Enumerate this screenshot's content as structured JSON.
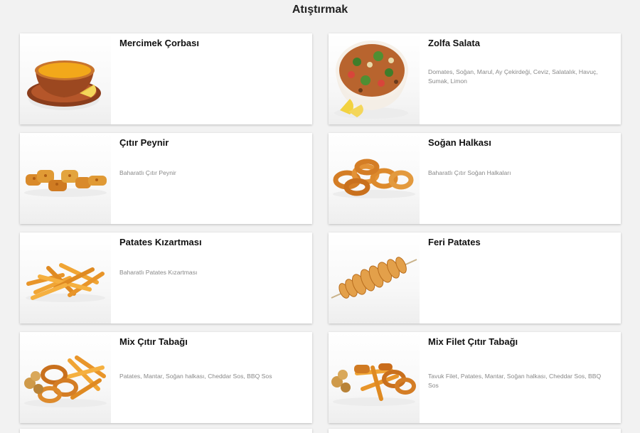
{
  "page": {
    "title": "Atıştırmak"
  },
  "items": [
    {
      "name": "Mercimek Çorbası",
      "description": "",
      "image": "lentil-soup-bowl"
    },
    {
      "name": "Zolfa Salata",
      "description": "Domates, Soğan, Marul, Ay Çekirdeği, Ceviz, Salatalık, Havuç, Sumak, Limon",
      "image": "salad-bowl"
    },
    {
      "name": "Çıtır Peynir",
      "description": "Baharatlı Çıtır Peynir",
      "image": "crispy-cheese"
    },
    {
      "name": "Soğan Halkası",
      "description": "Baharatlı Çıtır Soğan Halkaları",
      "image": "onion-rings"
    },
    {
      "name": "Patates Kızartması",
      "description": "Baharatlı Patates Kızartması",
      "image": "french-fries"
    },
    {
      "name": "Feri Patates",
      "description": "",
      "image": "spiral-potato"
    },
    {
      "name": "Mix Çıtır Tabağı",
      "description": "Patates, Mantar, Soğan halkası, Cheddar Sos, BBQ Sos",
      "image": "mix-platter"
    },
    {
      "name": "Mix Filet Çıtır Tabağı",
      "description": "Tavuk Filet, Patates, Mantar, Soğan halkası, Cheddar Sos, BBQ Sos",
      "image": "mix-fillet-platter"
    }
  ]
}
